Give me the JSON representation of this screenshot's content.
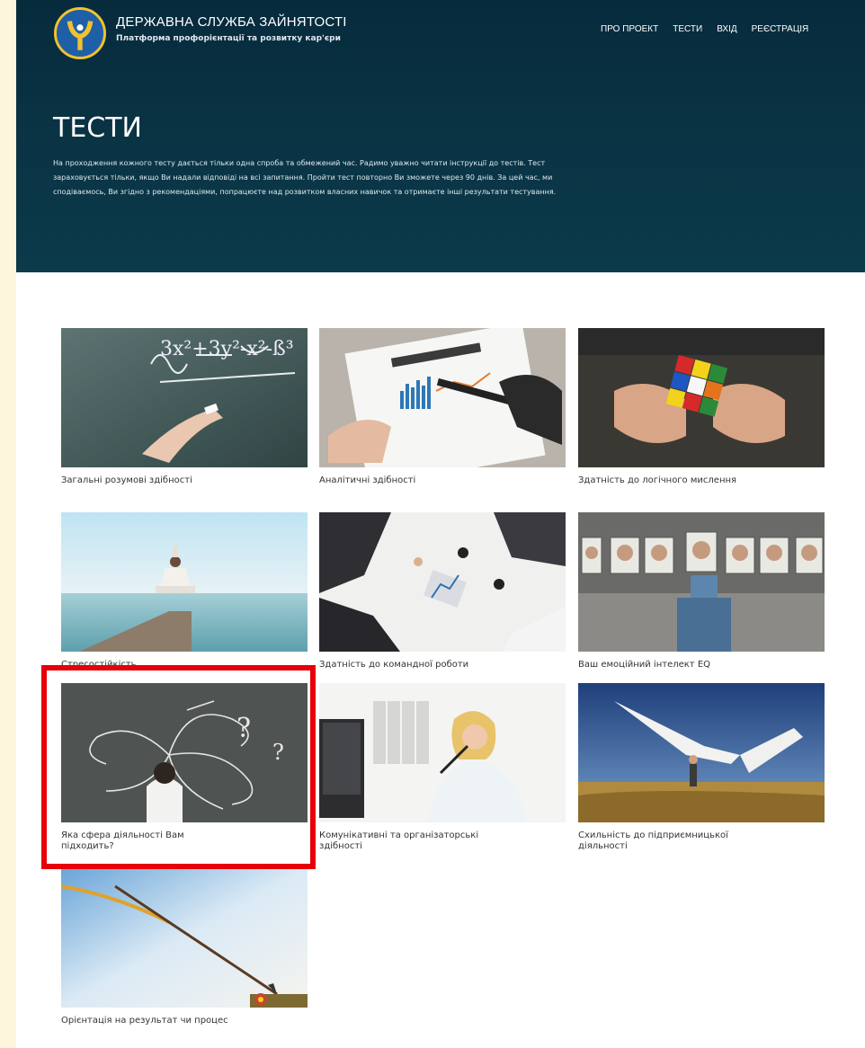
{
  "header": {
    "org_name": "ДЕРЖАВНА СЛУЖБА ЗАЙНЯТОСТІ",
    "subtitle": "Платформа профорієнтації та розвитку кар'єри",
    "nav": [
      "ПРО ПРОЕКТ",
      "ТЕСТИ",
      "ВХІД",
      "РЕЄСТРАЦІЯ"
    ]
  },
  "hero": {
    "title": "ТЕСТИ",
    "description": "На проходження кожного тесту дається тільки одна спроба та обмежений час. Радимо уважно читати інструкції до тестів. Тест зараховується тільки, якщо Ви надали відповіді на всі запитання. Пройти тест повторно Ви зможете через 90 днів. За цей час, ми сподіваємось, Ви згідно з рекомендаціями, попрацюєте над розвитком власних навичок та отримаєте інші результати тестування."
  },
  "tests": [
    {
      "label": "Загальні розумові здібності",
      "image": "chalkboard-math-photo"
    },
    {
      "label": "Аналітичні здібності",
      "image": "report-charts-photo"
    },
    {
      "label": "Здатність до логічного мислення",
      "image": "rubiks-cube-photo"
    },
    {
      "label": "Стресостійкість",
      "image": "meditation-pier-photo"
    },
    {
      "label": "Здатність до командної роботи",
      "image": "team-meeting-photo"
    },
    {
      "label": "Ваш емоційний інтелект EQ",
      "image": "emotion-faces-photo"
    },
    {
      "label": "Яка сфера діяльності Вам підходить?",
      "image": "question-marks-photo"
    },
    {
      "label": "Комунікативні та організаторські здібності",
      "image": "office-phone-photo"
    },
    {
      "label": "Схильність до підприємницької діяльності",
      "image": "paper-wing-photo"
    },
    {
      "label": "Орієнтація на результат чи процес",
      "image": "arrow-target-photo"
    }
  ],
  "colors": {
    "hero_bg": "#0a3445",
    "highlight": "#e5000a",
    "page_bg": "#fdf5dc"
  }
}
